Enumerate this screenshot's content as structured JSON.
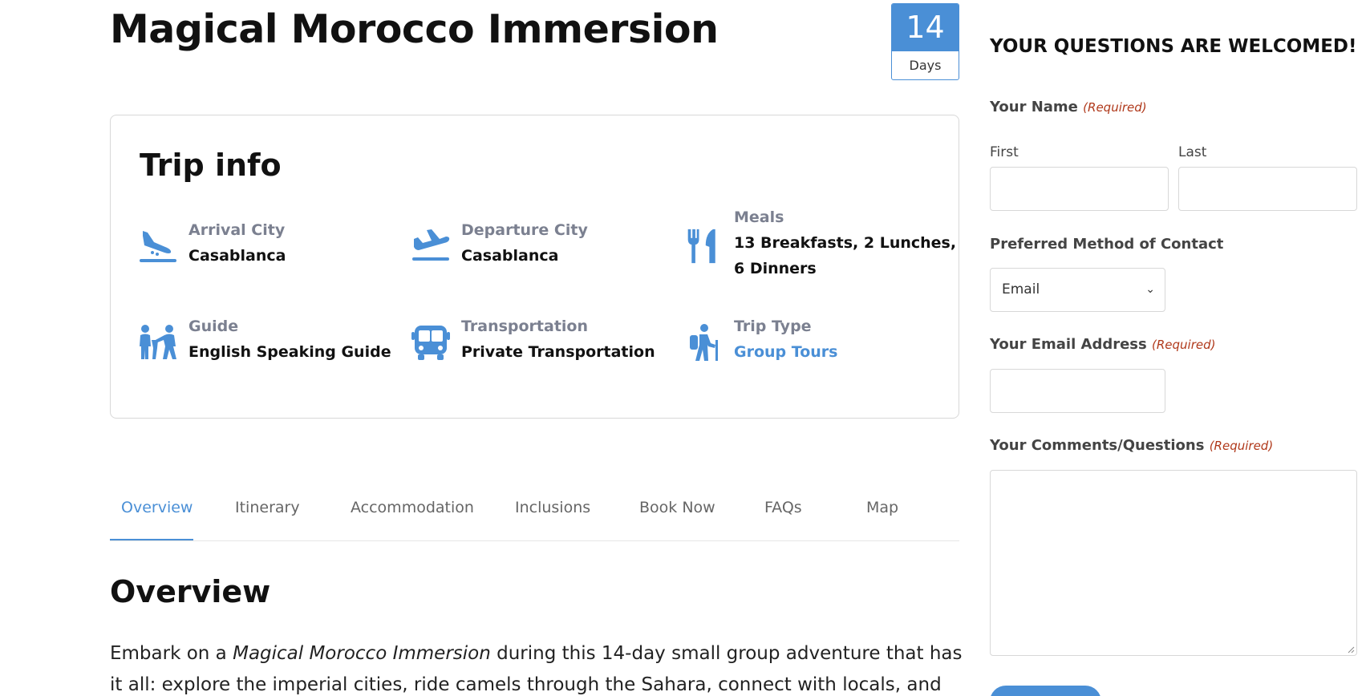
{
  "page": {
    "title": "Magical Morocco Immersion",
    "duration": {
      "number": "14",
      "unit": "Days"
    }
  },
  "trip_info": {
    "heading": "Trip info",
    "items": [
      {
        "icon": "plane-landing-icon",
        "label": "Arrival City",
        "value": "Casablanca"
      },
      {
        "icon": "plane-departure-icon",
        "label": "Departure City",
        "value": "Casablanca"
      },
      {
        "icon": "utensils-icon",
        "label": "Meals",
        "value_line1": "13 Breakfasts, 2 Lunches,",
        "value_line2": "6 Dinners"
      },
      {
        "icon": "guide-people-icon",
        "label": "Guide",
        "value": "English Speaking Guide"
      },
      {
        "icon": "bus-icon",
        "label": "Transportation",
        "value": "Private Transportation"
      },
      {
        "icon": "hiker-icon",
        "label": "Trip Type",
        "value": "Group Tours"
      }
    ]
  },
  "tabs": [
    "Overview",
    "Itinerary",
    "Accommodation",
    "Inclusions",
    "Book Now",
    "FAQs",
    "Map"
  ],
  "active_tab": "Overview",
  "overview": {
    "heading": "Overview",
    "p_before": "Embark on a ",
    "p_italic": "Magical Morocco Immersion",
    "p_after": " during this 14-day small group adventure that has it all: explore the imperial cities, ride camels through the Sahara, connect with locals, and"
  },
  "form": {
    "heading": "YOUR QUESTIONS ARE WELCOMED!",
    "required_text": "(Required)",
    "name_label": "Your Name",
    "first_label": "First",
    "last_label": "Last",
    "contact_label": "Preferred Method of Contact",
    "contact_selected": "Email",
    "email_label": "Your Email Address",
    "comments_label": "Your Comments/Questions"
  },
  "colors": {
    "accent": "#4a8fd6",
    "required": "#b0391b",
    "muted": "#7b8090"
  }
}
